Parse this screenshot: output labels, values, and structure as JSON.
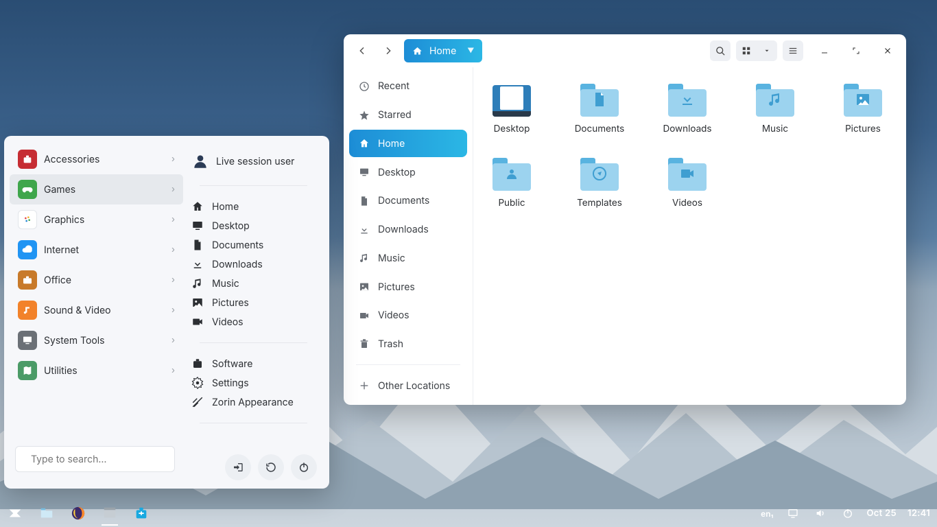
{
  "taskbar": {
    "indicators": {
      "keyboard": "en₁"
    },
    "date": "Oct 25",
    "time": "12:41"
  },
  "appmenu": {
    "categories": [
      {
        "label": "Accessories",
        "color": "#c62d33",
        "icon": "bag"
      },
      {
        "label": "Games",
        "color": "#3fa64b",
        "icon": "gamepad",
        "hover": true
      },
      {
        "label": "Graphics",
        "color": "#",
        "icon": "palette"
      },
      {
        "label": "Internet",
        "color": "#2094f3",
        "icon": "cloud"
      },
      {
        "label": "Office",
        "color": "#c87a2a",
        "icon": "briefcase"
      },
      {
        "label": "Sound & Video",
        "color": "#f2822a",
        "icon": "music"
      },
      {
        "label": "System Tools",
        "color": "#6b7076",
        "icon": "monitor"
      },
      {
        "label": "Utilities",
        "color": "#4b9b67",
        "icon": "map"
      }
    ],
    "search_placeholder": "Type to search…",
    "user": "Live session user",
    "places": [
      {
        "label": "Home",
        "icon": "home"
      },
      {
        "label": "Desktop",
        "icon": "desktop"
      },
      {
        "label": "Documents",
        "icon": "doc"
      },
      {
        "label": "Downloads",
        "icon": "download"
      },
      {
        "label": "Music",
        "icon": "music"
      },
      {
        "label": "Pictures",
        "icon": "picture"
      },
      {
        "label": "Videos",
        "icon": "video"
      }
    ],
    "system": [
      {
        "label": "Software",
        "icon": "software"
      },
      {
        "label": "Settings",
        "icon": "gear"
      },
      {
        "label": "Zorin Appearance",
        "icon": "appearance"
      }
    ]
  },
  "fm": {
    "location": "Home",
    "sidebar": [
      {
        "label": "Recent",
        "icon": "clock"
      },
      {
        "label": "Starred",
        "icon": "star"
      },
      {
        "label": "Home",
        "icon": "home",
        "active": true
      },
      {
        "label": "Desktop",
        "icon": "desktop"
      },
      {
        "label": "Documents",
        "icon": "doc"
      },
      {
        "label": "Downloads",
        "icon": "download"
      },
      {
        "label": "Music",
        "icon": "music"
      },
      {
        "label": "Pictures",
        "icon": "picture"
      },
      {
        "label": "Videos",
        "icon": "video"
      },
      {
        "label": "Trash",
        "icon": "trash"
      }
    ],
    "other_locations": "Other Locations",
    "folders": [
      {
        "label": "Desktop",
        "kind": "desktop"
      },
      {
        "label": "Documents",
        "glyph": "doc"
      },
      {
        "label": "Downloads",
        "glyph": "download"
      },
      {
        "label": "Music",
        "glyph": "music"
      },
      {
        "label": "Pictures",
        "glyph": "picture"
      },
      {
        "label": "Public",
        "glyph": "user"
      },
      {
        "label": "Templates",
        "glyph": "compass"
      },
      {
        "label": "Videos",
        "glyph": "video"
      }
    ]
  }
}
